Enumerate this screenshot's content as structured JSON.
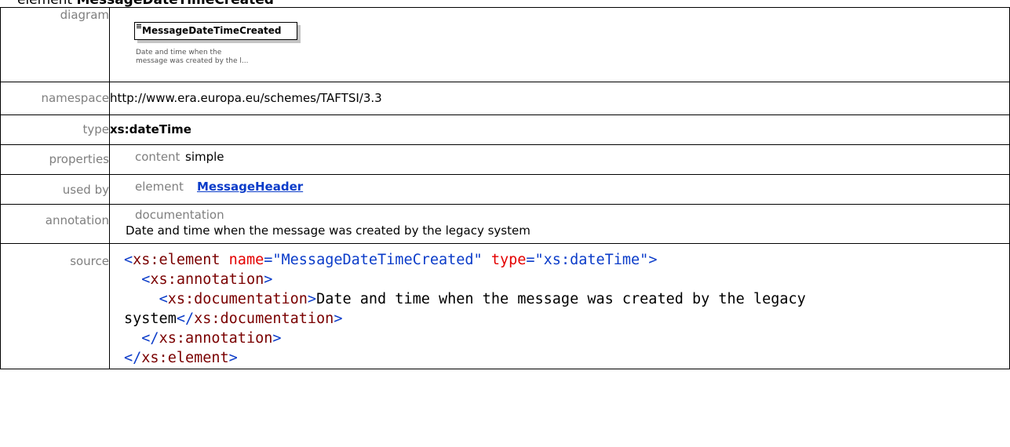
{
  "title": {
    "prefix": "element",
    "name": "MessageDateTimeCreated"
  },
  "rows": {
    "diagram": {
      "label": "diagram",
      "box_label": "MessageDateTimeCreated",
      "note_line1": "Date and time when the",
      "note_line2": "message was created by the l..."
    },
    "namespace": {
      "label": "namespace",
      "value": "http://www.era.europa.eu/schemes/TAFTSI/3.3"
    },
    "type": {
      "label": "type",
      "value": "xs:dateTime"
    },
    "properties": {
      "label": "properties",
      "key": "content",
      "value": "simple"
    },
    "used_by": {
      "label": "used by",
      "key": "element",
      "value": "MessageHeader"
    },
    "annotation": {
      "label": "annotation",
      "key": "documentation",
      "value": "Date and time when the message was created by the legacy system"
    },
    "source": {
      "label": "source",
      "lines": {
        "l1_open": "<",
        "l1_tag": "xs:element",
        "l1_attr1": "name",
        "l1_eq1": "=",
        "l1_val1": "\"MessageDateTimeCreated\"",
        "l1_attr2": "type",
        "l1_eq2": "=",
        "l1_val2": "\"xs:dateTime\"",
        "l1_close": ">",
        "l2_open": "<",
        "l2_tag": "xs:annotation",
        "l2_close": ">",
        "l3_open": "<",
        "l3_tag": "xs:documentation",
        "l3_close": ">",
        "l3_text": "Date and time when the message was created by the legacy system",
        "l3_end_open": "</",
        "l3_end_tag": "xs:documentation",
        "l3_end_close": ">",
        "l4_open": "</",
        "l4_tag": "xs:annotation",
        "l4_close": ">",
        "l5_open": "</",
        "l5_tag": "xs:element",
        "l5_close": ">"
      }
    }
  }
}
